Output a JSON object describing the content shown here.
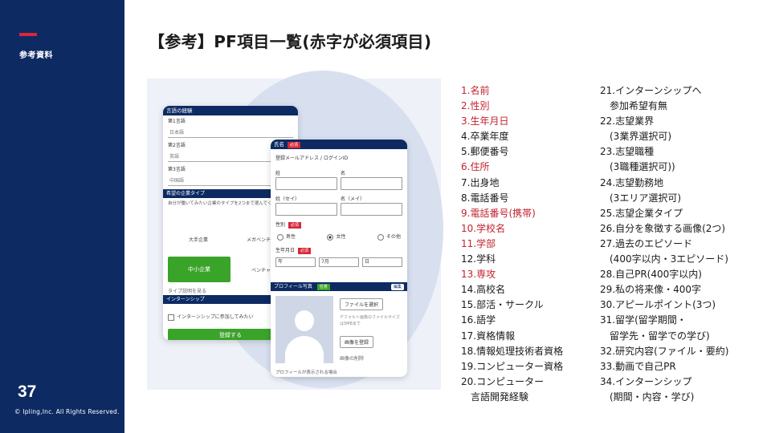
{
  "sidebar": {
    "label": "参考資料",
    "page_number": "37",
    "copyright": "© Ipling,Inc. All Rights Reserved."
  },
  "title": "【参考】PF項目一覧(赤字が必須項目)",
  "colors": {
    "navy": "#0d2a63",
    "red": "#c0232f",
    "green": "#3aa329"
  },
  "mockup": {
    "phone1": {
      "header": "言語の経験",
      "rows": [
        "第1言語",
        "第2言語",
        "第3言語"
      ],
      "values": [
        "日本語",
        "英語",
        "中国語"
      ],
      "section2": "希望の企業タイプ",
      "desc": "自分が働いてみたい企業のタイプを2つまで選んでください。",
      "opt1": "大手企業",
      "opt2": "メガベンチャー",
      "green_label": "中小企業",
      "opt3": "ベンチャー",
      "link": "タイプ説明を見る",
      "section3": "インターンシップ",
      "check": "インターンシップに参加してみたい",
      "button": "登録する"
    },
    "phone2": {
      "header": "氏名",
      "req": "必須",
      "login": "登録メールアドレス / ログインID",
      "sei": "姓",
      "mei": "名",
      "sei_kana": "姓（セイ）",
      "mei_kana": "名（メイ）",
      "gender": "性別",
      "male": "男性",
      "female": "女性",
      "other": "その他",
      "dob": "生年月日",
      "year": "年",
      "month": "7月",
      "day": "日",
      "profile": "プロフィール写真",
      "badge": "任意",
      "edit": "編集",
      "upload": "ファイルを選択",
      "note": "デフォルト画像のファイルサイズは5MBまで",
      "register": "画像を登録",
      "delete": "画像の削除",
      "foot": "プロフィールが表示される場合"
    }
  },
  "list_left": [
    {
      "text": "1.名前",
      "required": true
    },
    {
      "text": "2.性別",
      "required": true
    },
    {
      "text": "3.生年月日",
      "required": true
    },
    {
      "text": "4.卒業年度",
      "required": false
    },
    {
      "text": "5.郵便番号",
      "required": false
    },
    {
      "text": "6.住所",
      "required": true
    },
    {
      "text": "7.出身地",
      "required": false
    },
    {
      "text": "8.電話番号",
      "required": false
    },
    {
      "text": "9.電話番号(携帯)",
      "required": true
    },
    {
      "text": "10.学校名",
      "required": true
    },
    {
      "text": "11.学部",
      "required": true
    },
    {
      "text": "12.学科",
      "required": false
    },
    {
      "text": "13.専攻",
      "required": true
    },
    {
      "text": "14.高校名",
      "required": false
    },
    {
      "text": "15.部活・サークル",
      "required": false
    },
    {
      "text": "16.語学",
      "required": false
    },
    {
      "text": "17.資格情報",
      "required": false
    },
    {
      "text": "18.情報処理技術者資格",
      "required": false
    },
    {
      "text": "19.コンピューター資格",
      "required": false
    },
    {
      "text": "20.コンピューター",
      "required": false
    },
    {
      "text": "言語開発経験",
      "required": false,
      "indent": true
    }
  ],
  "list_right": [
    {
      "text": "21.インターンシップへ",
      "indent": false
    },
    {
      "text": "参加希望有無",
      "indent": true
    },
    {
      "text": "22.志望業界",
      "indent": false
    },
    {
      "text": "(3業界選択可)",
      "indent": true
    },
    {
      "text": "23.志望職種",
      "indent": false
    },
    {
      "text": "(3職種選択可))",
      "indent": true
    },
    {
      "text": "24.志望勤務地",
      "indent": false
    },
    {
      "text": "(3エリア選択可)",
      "indent": true
    },
    {
      "text": "25.志望企業タイプ",
      "indent": false
    },
    {
      "text": "26.自分を象徴する画像(2つ)",
      "indent": false
    },
    {
      "text": "27.過去のエピソード",
      "indent": false
    },
    {
      "text": "(400字以内・3エピソード)",
      "indent": true
    },
    {
      "text": "28.自己PR(400字以内)",
      "indent": false
    },
    {
      "text": "29.私の将来像・400字",
      "indent": false
    },
    {
      "text": "30.アピールポイント(3つ)",
      "indent": false
    },
    {
      "text": "31.留学(留学期間・",
      "indent": false
    },
    {
      "text": "留学先・留学での学び)",
      "indent": true
    },
    {
      "text": "32.研究内容(ファイル・要約)",
      "indent": false
    },
    {
      "text": "33.動画で自己PR",
      "indent": false
    },
    {
      "text": "34.インターンシップ",
      "indent": false
    },
    {
      "text": "(期間・内容・学び)",
      "indent": true
    }
  ]
}
